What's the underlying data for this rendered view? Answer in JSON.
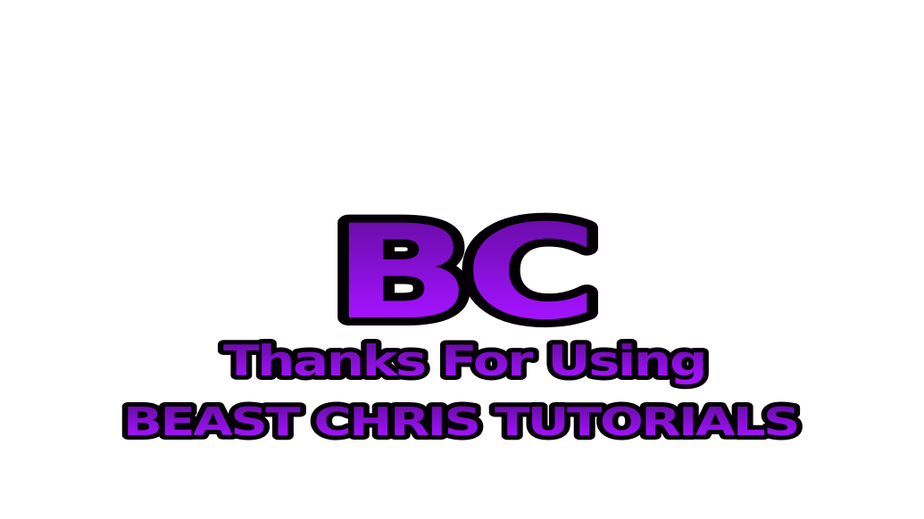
{
  "logo": {
    "mark": "BC",
    "line1": "Thanks For Using",
    "line2": "BEAST CHRIS TUTORIALS"
  },
  "colors": {
    "background": "#ffffff",
    "outline": "#050005",
    "purple_light": "#a313ff",
    "purple_dark": "#5f0b9a"
  }
}
